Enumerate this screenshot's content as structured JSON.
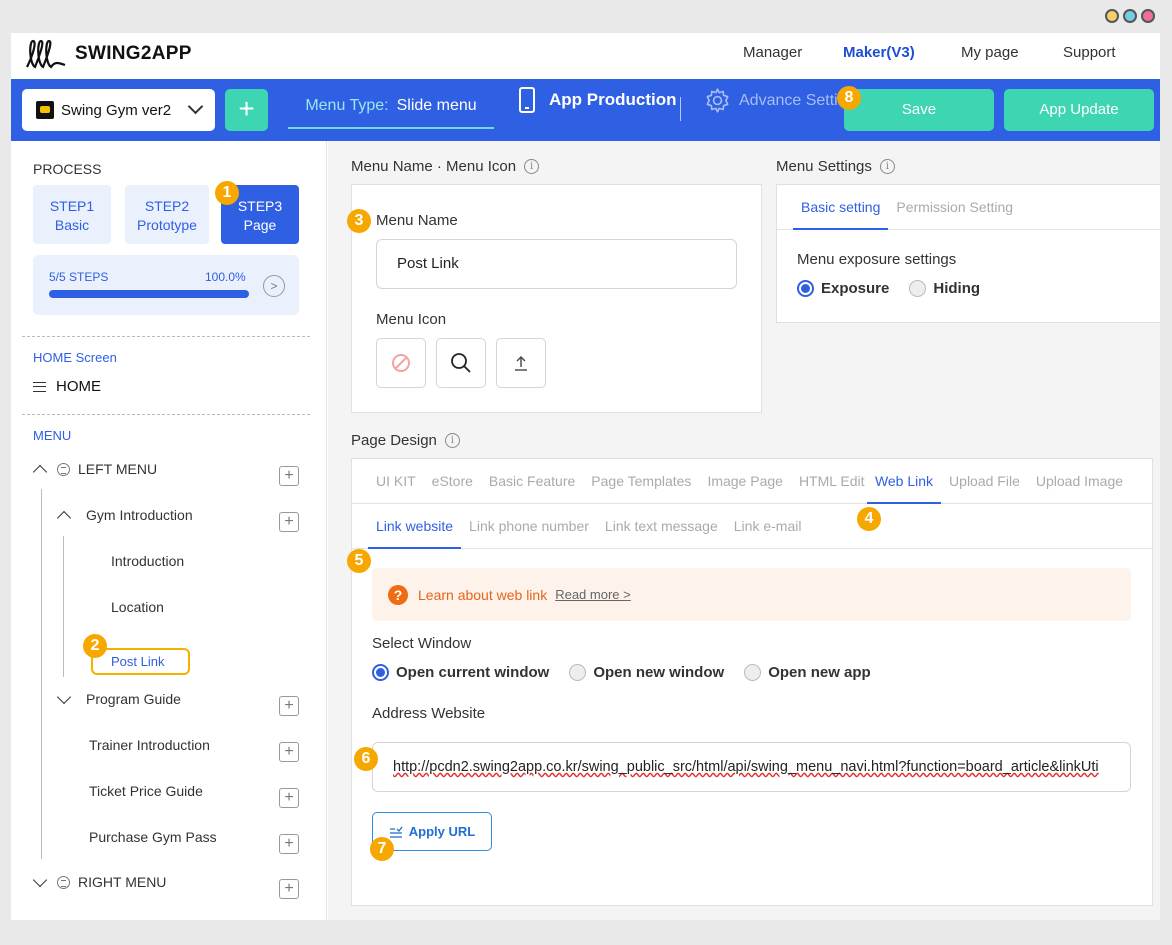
{
  "topnav": {
    "brand": "SWING2APP",
    "links": [
      "Manager",
      "Maker(V3)",
      "My page",
      "Support"
    ],
    "active_link": "Maker(V3)"
  },
  "toolbar": {
    "app_name": "Swing Gym ver2",
    "add_label": "+",
    "menu_type_label": "Menu Type:",
    "menu_type_value": "Slide menu",
    "app_production": "App Production",
    "advance_setting": "Advance Settir",
    "save_label": "Save",
    "update_label": "App Update"
  },
  "sidebar": {
    "process_label": "PROCESS",
    "steps": [
      {
        "line1": "STEP1",
        "line2": "Basic"
      },
      {
        "line1": "STEP2",
        "line2": "Prototype"
      },
      {
        "line1": "STEP3",
        "line2": "Page"
      }
    ],
    "progress_label": "5/5 STEPS",
    "progress_pct": "100.0%",
    "progress_value": 1.0,
    "home_screen_label": "HOME Screen",
    "home_item": "HOME",
    "menu_label": "MENU",
    "left_menu": "LEFT MENU",
    "gym_intro": "Gym Introduction",
    "introduction": "Introduction",
    "location": "Location",
    "post_link": "Post Link",
    "program_guide": "Program Guide",
    "trainer_intro": "Trainer Introduction",
    "ticket_guide": "Ticket Price Guide",
    "purchase_pass": "Purchase Gym Pass",
    "right_menu": "RIGHT MENU"
  },
  "badges": [
    "1",
    "2",
    "3",
    "4",
    "5",
    "6",
    "7",
    "8"
  ],
  "menu_name_section": {
    "title": "Menu Name · Menu Icon",
    "name_label": "Menu Name",
    "name_value": "Post Link",
    "icon_label": "Menu Icon"
  },
  "menu_settings": {
    "title": "Menu Settings",
    "tabs": [
      "Basic setting",
      "Permission Setting"
    ],
    "exposure_label": "Menu exposure settings",
    "options": [
      "Exposure",
      "Hiding"
    ]
  },
  "page_design": {
    "title": "Page Design",
    "tabs": [
      "UI KIT",
      "eStore",
      "Basic Feature",
      "Page Templates",
      "Image Page",
      "HTML Edit",
      "Web Link",
      "Upload File",
      "Upload Image"
    ],
    "subtabs": [
      "Link website",
      "Link phone number",
      "Link text message",
      "Link e-mail"
    ],
    "help_text": "Learn about web link",
    "read_more": "Read more",
    "select_window_label": "Select Window",
    "window_options": [
      "Open current window",
      "Open new window",
      "Open new app"
    ],
    "address_label": "Address Website",
    "address_value": "http://pcdn2.swing2app.co.kr/swing_public_src/html/api/swing_menu_navi.html?function=board_article&linkUti",
    "apply_label": "Apply URL"
  },
  "colors": {
    "primary_blue": "#2f5fe2",
    "accent_teal": "#3ed5b3",
    "badge_orange": "#f6a800"
  }
}
